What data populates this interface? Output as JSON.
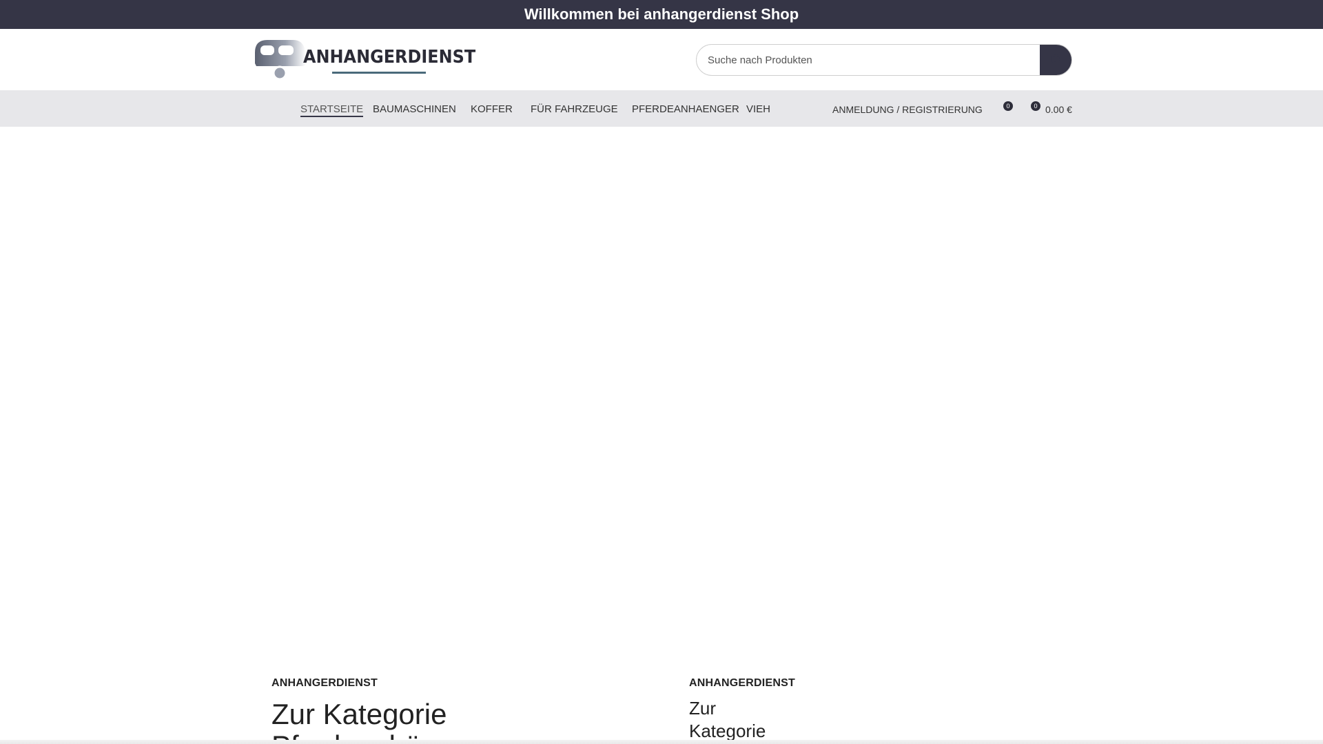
{
  "topbar": {
    "welcome": "Willkommen bei anhangerdienst Shop"
  },
  "header": {
    "logo_text": "ANHANGERDIENST",
    "search": {
      "placeholder": "Suche nach Produkten",
      "value": ""
    }
  },
  "nav": {
    "items": [
      {
        "label": "STARTSEITE",
        "active": true
      },
      {
        "label": "BAUMASCHINEN"
      },
      {
        "label": "KOFFER"
      },
      {
        "label": "FÜR FAHRZEUGE"
      },
      {
        "label": "PFERDEANHAENGER"
      },
      {
        "label": "VIEH"
      }
    ],
    "login": "ANMELDUNG / REGISTRIERUNG",
    "wishlist_count": "0",
    "cart_count": "0",
    "cart_total": "0.00 €"
  },
  "cards": [
    {
      "brand": "ANHANGERDIENST",
      "title_line1": "Zur Kategorie",
      "title_line2": "Pferdeanhänger"
    },
    {
      "brand": "ANHANGERDIENST",
      "title_line1": "Zur",
      "title_line2": "Kategorie"
    }
  ],
  "colors": {
    "dark": "#353546",
    "nav_bg": "#e7e7ea"
  },
  "icons": {
    "search": "search-icon",
    "wishlist": "heart-icon",
    "cart": "cart-icon"
  }
}
